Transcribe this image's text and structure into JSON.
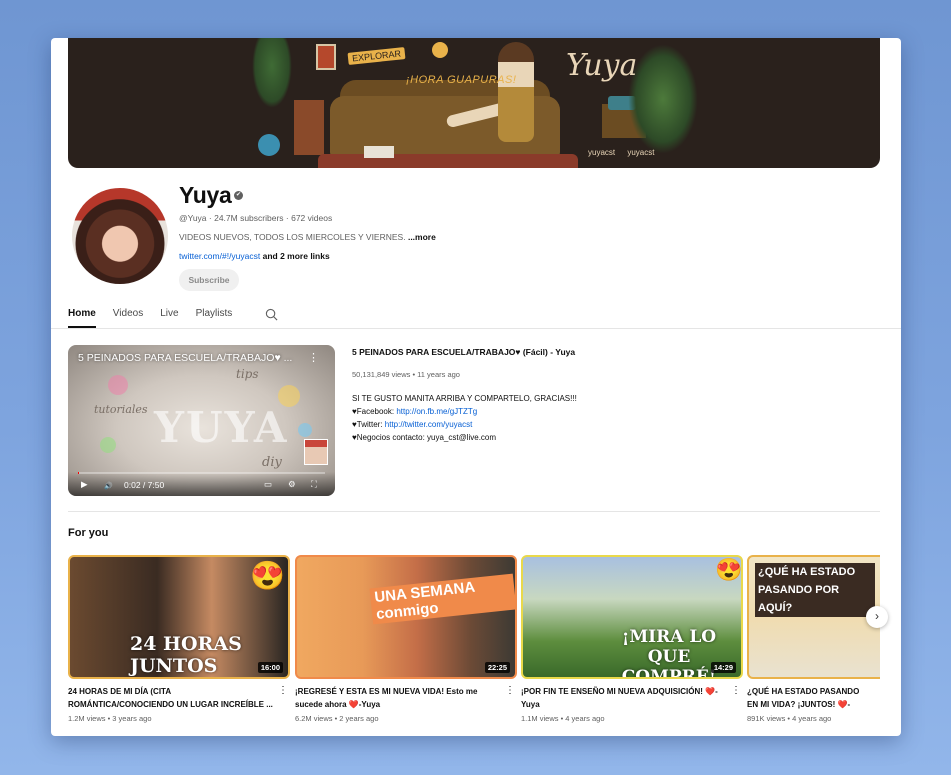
{
  "banner": {
    "tag": "EXPLORAR",
    "headline": "¡HORA GUAPURAS!",
    "signature": "Yuya",
    "socials": [
      "yuyacst",
      "yuyacst"
    ]
  },
  "channel": {
    "name": "Yuya",
    "verified_glyph": "✔",
    "meta": "@Yuya · 24.7M subscribers · 672 videos",
    "description": "VIDEOS NUEVOS, TODOS LOS MIERCOLES Y VIERNES.",
    "description_more": "...more",
    "link": "twitter.com/#!/yuyacst",
    "link_more": " and 2 more links",
    "subscribe_label": "Subscribe"
  },
  "tabs": [
    {
      "label": "Home",
      "active": true
    },
    {
      "label": "Videos",
      "active": false
    },
    {
      "label": "Live",
      "active": false
    },
    {
      "label": "Playlists",
      "active": false
    }
  ],
  "featured": {
    "player_title": "5 PEINADOS PARA ESCUELA/TRABAJO♥ ...",
    "watermark": "YUYA",
    "scripts": [
      "tutoriales",
      "tips",
      "diy"
    ],
    "time": "0:02 / 7:50",
    "title": "5 PEINADOS PARA ESCUELA/TRABAJO♥ (Fácil) - Yuya",
    "meta": "50,131,849 views • 11 years ago",
    "desc_lines": [
      {
        "text": "SI TE GUSTO MANITA ARRIBA Y COMPARTELO, GRACIAS!!!",
        "link": ""
      },
      {
        "text": "♥Facebook: ",
        "link": "http://on.fb.me/gJTZTg"
      },
      {
        "text": "♥Twitter: ",
        "link": "http://twitter.com/yuyacst"
      },
      {
        "text": "♥Negocios contacto: yuya_cst@live.com",
        "link": ""
      }
    ],
    "progress": 0.004
  },
  "section_title": "For you",
  "videos": [
    {
      "title": "24 HORAS DE MI DÍA (CITA ROMÁNTICA/CONOCIENDO UN LUGAR INCREÍBLE ...",
      "meta": "1.2M views • 3 years ago",
      "duration": "16:00",
      "overlay": "24 HORAS JUNTOS",
      "emoji": "😍"
    },
    {
      "title": "¡REGRESÉ Y ESTA ES MI NUEVA VIDA! Esto me sucede ahora ❤️-Yuya",
      "meta": "6.2M views • 2 years ago",
      "duration": "22:25",
      "overlay": "UNA SEMANA conmigo",
      "emoji": ""
    },
    {
      "title": "¡POR FIN TE ENSEÑO MI NUEVA ADQUISICIÓN! ❤️- Yuya",
      "meta": "1.1M views • 4 years ago",
      "duration": "14:29",
      "overlay": "¡MIRA LO QUE COMPRÉ!",
      "emoji": "😍"
    },
    {
      "title": "¿QUÉ HA ESTADO PASANDO EN MI VIDA? ¡JUNTOS! ❤️-Yuya",
      "meta": "891K views • 4 years ago",
      "duration": "",
      "overlay": "¿QUÉ HA ESTADO PASANDO POR AQUÍ?",
      "emoji": ""
    }
  ],
  "icons": {
    "play": "▶",
    "volume": "🔊",
    "cc": "▭",
    "settings": "⚙",
    "fullscreen": "⛶",
    "more": "⋮",
    "next": "›"
  }
}
